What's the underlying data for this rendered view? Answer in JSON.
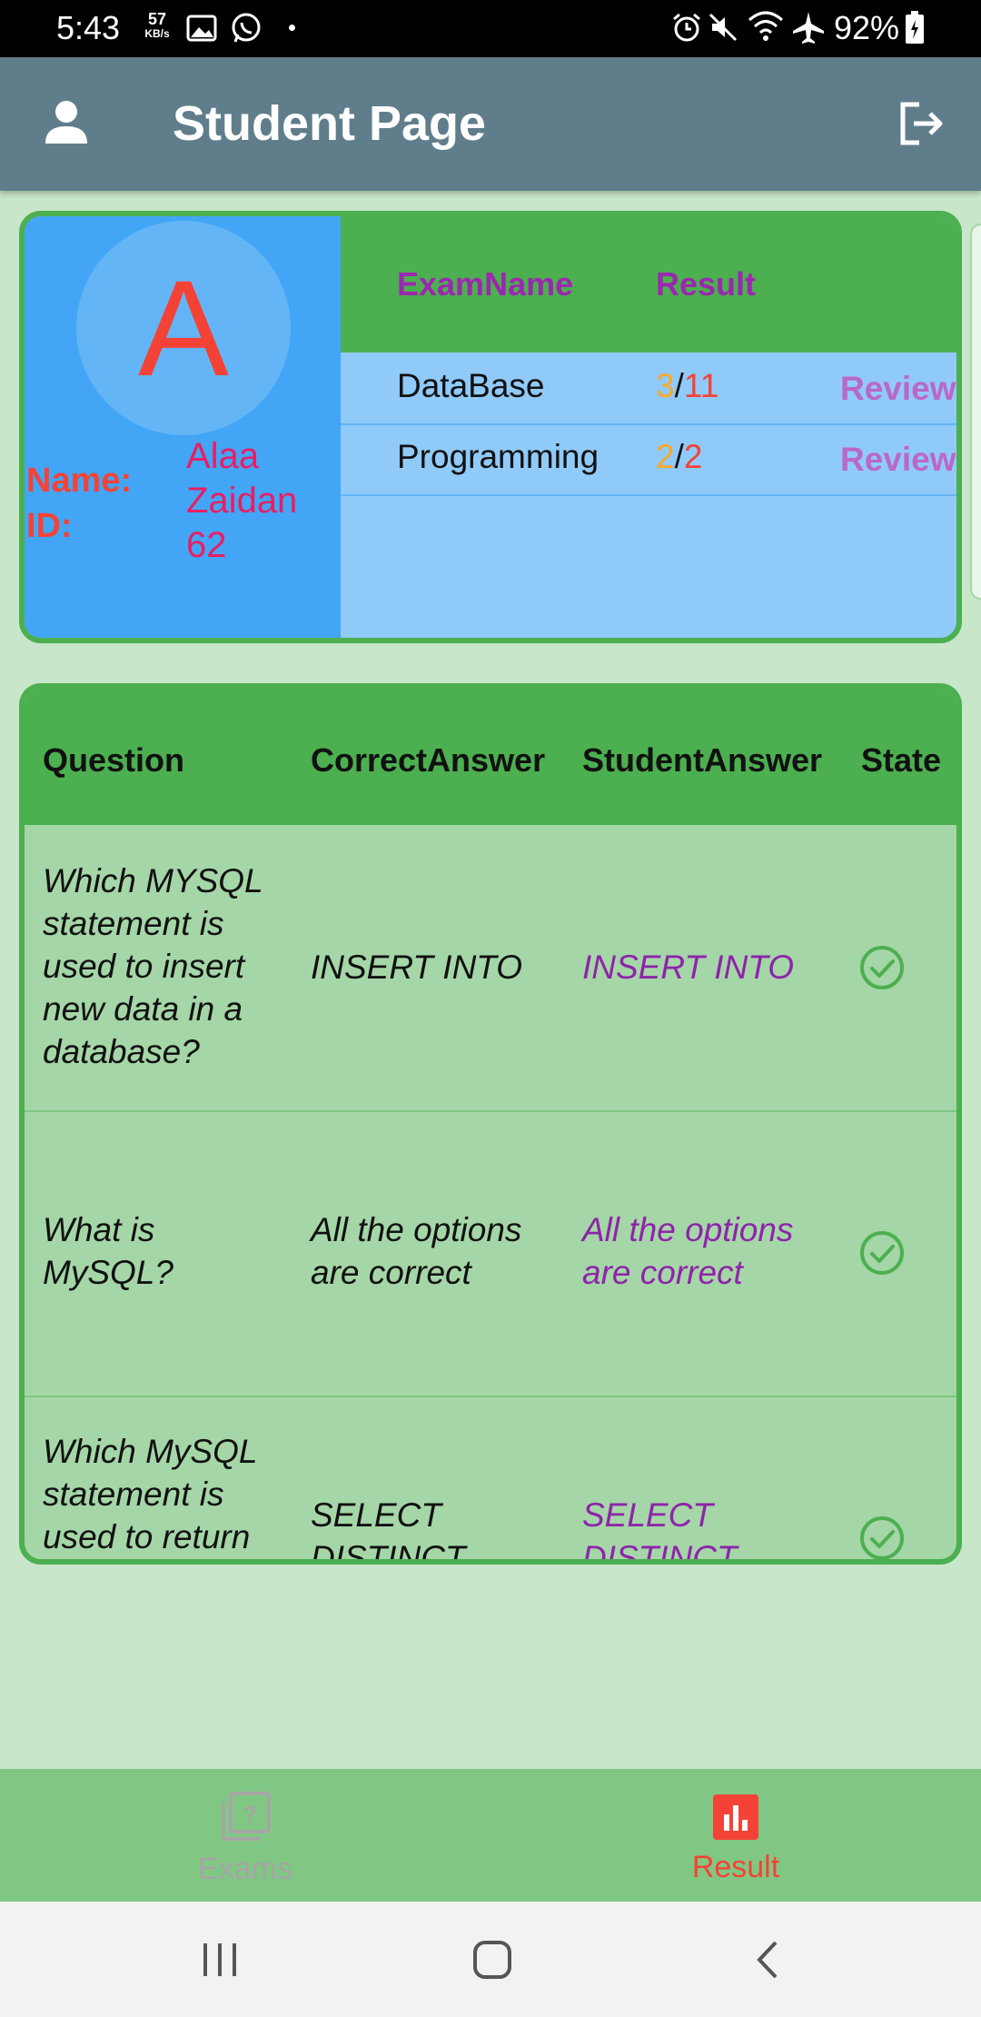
{
  "status_bar": {
    "time": "5:43",
    "speed_value": "57",
    "speed_unit": "KB/s",
    "battery": "92%"
  },
  "app_bar": {
    "title": "Student Page",
    "account_icon": "account-icon",
    "logout_icon": "logout-icon"
  },
  "profile": {
    "avatar_letter": "A",
    "name_label": "Name:",
    "id_label": "ID:",
    "first_name": "Alaa",
    "last_name": "Zaidan",
    "id_value": "62"
  },
  "exams": {
    "headers": {
      "exam_name": "ExamName",
      "result": "Result"
    },
    "rows": [
      {
        "name": "DataBase",
        "score": "3",
        "sep": "/",
        "total": "11",
        "action": "Review"
      },
      {
        "name": "Programming",
        "score": "2",
        "sep": "/",
        "total": "2",
        "action": "Review"
      }
    ]
  },
  "questions": {
    "headers": {
      "question": "Question",
      "correct": "CorrectAnswer",
      "student": "StudentAnswer",
      "state": "State"
    },
    "rows": [
      {
        "question": "Which MYSQL statement is used to insert new data in a database?",
        "correct": "INSERT INTO",
        "student": "INSERT INTO",
        "state": "check-circle-icon"
      },
      {
        "question": "What is MySQL?",
        "correct": "All the options are correct",
        "student": "All the options are correct",
        "state": "check-circle-icon"
      },
      {
        "question": "Which MySQL statement is used to return",
        "correct": "SELECT DISTINCT",
        "student": "SELECT DISTINCT",
        "state": "check-circle-icon"
      }
    ]
  },
  "bottom_nav": {
    "items": [
      {
        "label": "Exams",
        "icon": "quiz-icon",
        "active": false
      },
      {
        "label": "Result",
        "icon": "bar-chart-icon",
        "active": true
      }
    ]
  },
  "colors": {
    "app_bar": "#607d8b",
    "card_border": "#4caf50",
    "active_nav": "#f44336",
    "inactive_nav": "#a5a5a5"
  }
}
